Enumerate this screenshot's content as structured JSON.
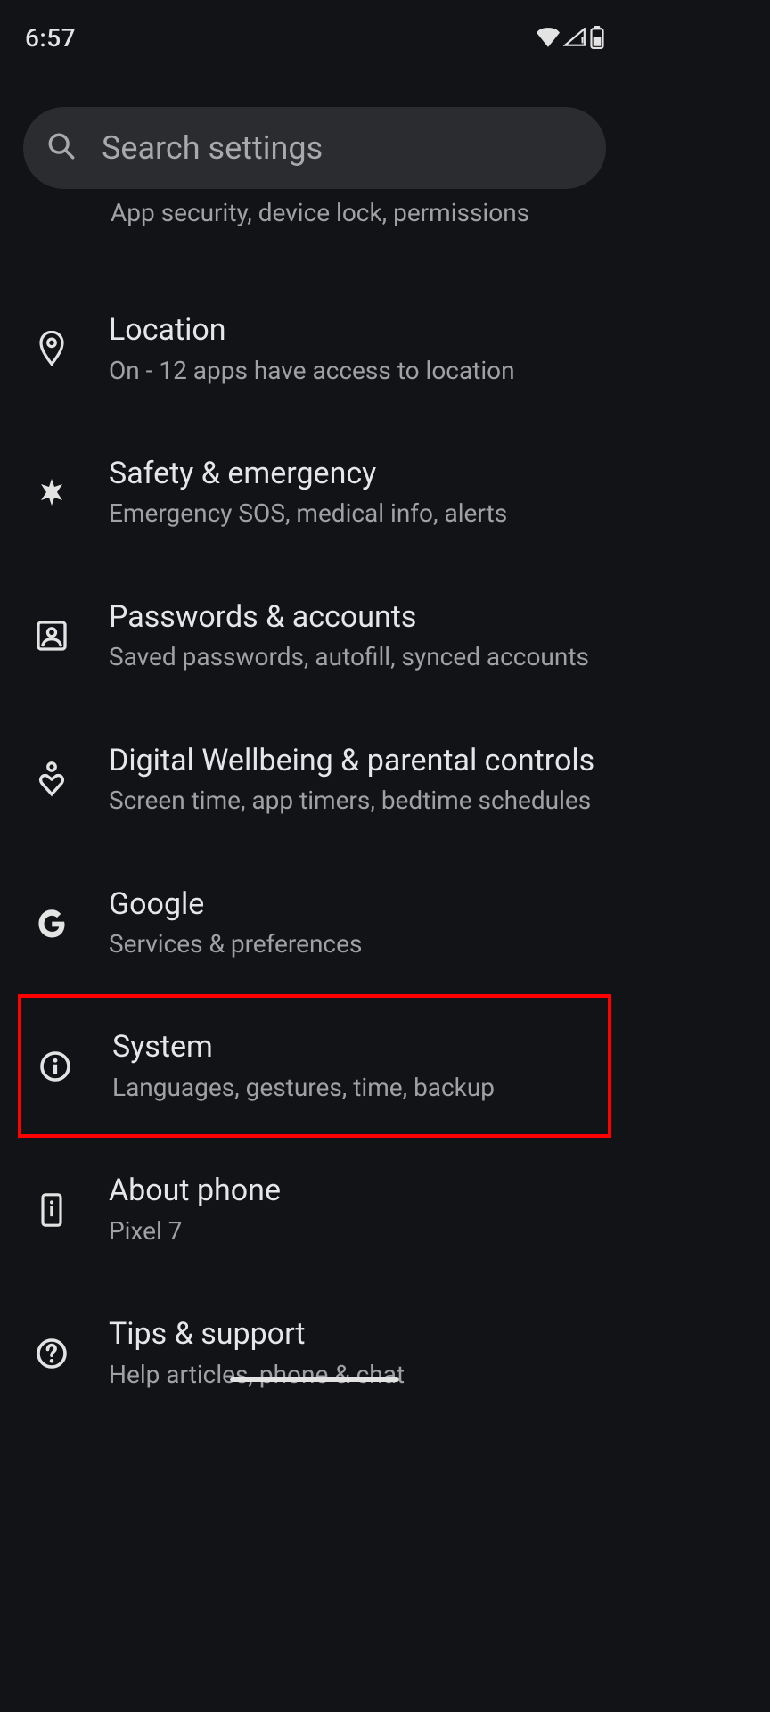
{
  "status": {
    "time": "6:57"
  },
  "search": {
    "placeholder": "Search settings"
  },
  "partial": {
    "subtitle": "App security, device lock, permissions"
  },
  "items": [
    {
      "icon": "location-pin-icon",
      "title": "Location",
      "subtitle": "On - 12 apps have access to location"
    },
    {
      "icon": "medical-icon",
      "title": "Safety & emergency",
      "subtitle": "Emergency SOS, medical info, alerts"
    },
    {
      "icon": "account-box-icon",
      "title": "Passwords & accounts",
      "subtitle": "Saved passwords, autofill, synced accounts"
    },
    {
      "icon": "wellbeing-icon",
      "title": "Digital Wellbeing & parental controls",
      "subtitle": "Screen time, app timers, bedtime schedules"
    },
    {
      "icon": "google-icon",
      "title": "Google",
      "subtitle": "Services & preferences"
    },
    {
      "icon": "info-icon",
      "title": "System",
      "subtitle": "Languages, gestures, time, backup",
      "highlighted": true
    },
    {
      "icon": "phone-device-icon",
      "title": "About phone",
      "subtitle": "Pixel 7"
    },
    {
      "icon": "help-icon",
      "title": "Tips & support",
      "subtitle": "Help articles, phone & chat"
    }
  ]
}
